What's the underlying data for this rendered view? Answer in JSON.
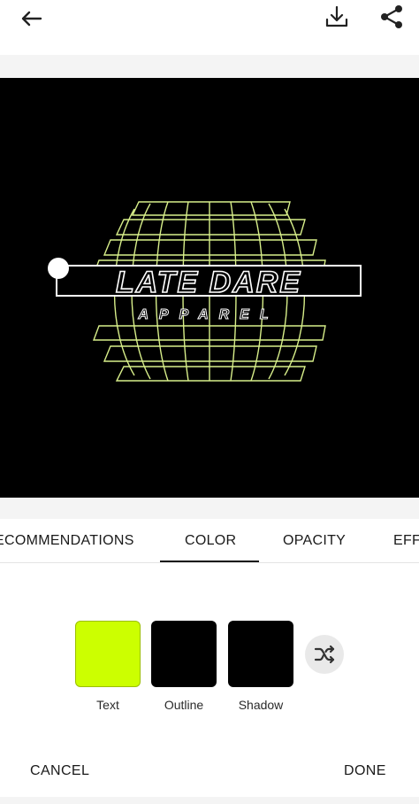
{
  "header": {
    "back_icon": "arrow-left-icon",
    "download_icon": "download-icon",
    "share_icon": "share-icon"
  },
  "design": {
    "title": "LATE DARE",
    "subtitle": "APPAREL",
    "background_color": "#000000",
    "grid_color": "#d8ef8a"
  },
  "tabs": {
    "recommendations": "ECOMMENDATIONS",
    "color": "COLOR",
    "opacity": "OPACITY",
    "effects": "EFF",
    "active": "COLOR"
  },
  "colors": {
    "text_label": "Text",
    "text_color": "#ccff00",
    "outline_label": "Outline",
    "outline_color": "#000000",
    "shadow_label": "Shadow",
    "shadow_color": "#000000",
    "shuffle_icon": "shuffle-icon"
  },
  "footer": {
    "cancel_label": "CANCEL",
    "done_label": "DONE"
  }
}
